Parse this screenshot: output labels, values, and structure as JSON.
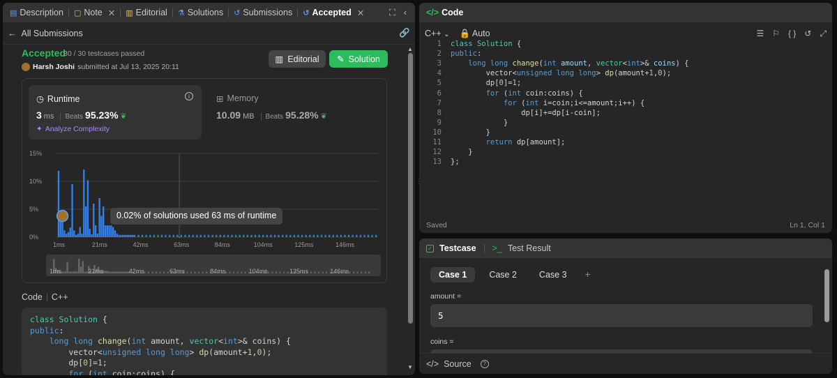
{
  "tabs": [
    {
      "icon": "document-icon",
      "label": "Description"
    },
    {
      "icon": "note-icon",
      "label": "Note",
      "closable": true
    },
    {
      "icon": "book-icon",
      "label": "Editorial"
    },
    {
      "icon": "flask-icon",
      "label": "Solutions"
    },
    {
      "icon": "history-icon",
      "label": "Submissions"
    },
    {
      "icon": "history-icon",
      "label": "Accepted",
      "closable": true,
      "active": true
    }
  ],
  "subbar": {
    "back_label": "All Submissions"
  },
  "submission": {
    "status": "Accepted",
    "testcases": "30 / 30 testcases passed",
    "user": "Harsh Joshi",
    "submitted_text": "submitted at Jul 13, 2025 20:11",
    "editorial_btn": "Editorial",
    "solution_btn": "Solution"
  },
  "runtime": {
    "label": "Runtime",
    "value": "3",
    "unit": "ms",
    "beats_label": "Beats",
    "beats": "95.23%",
    "analyze": "Analyze Complexity"
  },
  "memory": {
    "label": "Memory",
    "value": "10.09",
    "unit": "MB",
    "beats_label": "Beats",
    "beats": "95.28%"
  },
  "chart_data": {
    "type": "bar",
    "ylabels": [
      "15%",
      "10%",
      "5%",
      "0%"
    ],
    "yticks": [
      15,
      10,
      5,
      0
    ],
    "ylim": [
      0,
      15
    ],
    "xlabels": [
      "1ms",
      "21ms",
      "42ms",
      "63ms",
      "84ms",
      "104ms",
      "125ms",
      "146ms"
    ],
    "xticks": [
      1,
      21,
      42,
      63,
      84,
      104,
      125,
      146
    ],
    "xlim": [
      1,
      165
    ],
    "highlight_ms": 63,
    "user_ms": 3,
    "x": [
      1,
      2,
      3,
      4,
      5,
      6,
      7,
      8,
      9,
      10,
      11,
      12,
      13,
      14,
      15,
      16,
      17,
      18,
      19,
      20,
      21,
      22,
      23,
      24,
      25,
      26,
      27,
      28,
      29,
      30,
      31,
      32,
      33,
      34,
      35,
      36,
      37,
      38,
      39,
      40,
      42,
      44,
      46,
      48,
      50,
      52,
      54,
      56,
      58,
      60,
      62,
      63,
      64,
      66,
      68,
      70,
      72,
      74,
      76,
      78,
      80,
      82,
      84,
      86,
      88,
      90,
      92,
      94,
      96,
      98,
      100,
      102,
      104,
      106,
      108,
      110,
      112,
      114,
      116,
      118,
      120,
      122,
      124,
      126,
      128,
      130,
      132,
      134,
      136,
      138,
      140,
      142,
      144,
      146,
      148,
      150,
      152,
      154,
      156,
      158,
      160,
      162,
      164
    ],
    "values": [
      11.9,
      4.5,
      2.8,
      1.2,
      0.6,
      0.9,
      1.7,
      9.5,
      1.2,
      0.4,
      0.6,
      1.8,
      0.6,
      12.1,
      5.5,
      10.2,
      1.5,
      0.5,
      6,
      2.1,
      0.6,
      7,
      3.8,
      5.5,
      2.1,
      2.1,
      2.1,
      2.1,
      1.8,
      1.2,
      0.6,
      0.4,
      0.4,
      0.4,
      0.4,
      0.4,
      0.4,
      0.4,
      0.4,
      0.4,
      0.4,
      0.4,
      0.4,
      0.4,
      0.4,
      0.4,
      0.4,
      0.4,
      0.4,
      0.4,
      0.4,
      0.02,
      0.4,
      0.4,
      0.4,
      0.4,
      0.4,
      0.4,
      0.4,
      0.4,
      0.4,
      0.4,
      0.4,
      0.4,
      0.4,
      0.4,
      0.4,
      0.4,
      0.4,
      0.4,
      0.4,
      0.4,
      0.4,
      0.4,
      0.4,
      0.4,
      0.4,
      0.4,
      0.4,
      0.4,
      0.4,
      0.4,
      0.4,
      0.4,
      0.4,
      0.4,
      0.4,
      0.4,
      0.4,
      0.4,
      0.4,
      0.4,
      0.4,
      0.4,
      0.4,
      0.4,
      0.4,
      0.4,
      0.4,
      0.4,
      0.4,
      0.4,
      0.4
    ],
    "tooltip": "0.02% of solutions used 63 ms of runtime"
  },
  "code_section": {
    "label": "Code",
    "lang": "C++"
  },
  "code_preview": [
    [
      [
        "ty",
        "class "
      ],
      [
        "ty",
        "Solution"
      ],
      [
        "pl",
        " {"
      ]
    ],
    [
      [
        "kw",
        "public"
      ],
      [
        "pl",
        ":"
      ]
    ],
    [
      [
        "pl",
        "    "
      ],
      [
        "kw",
        "long long "
      ],
      [
        "fn",
        "change"
      ],
      [
        "pl",
        "("
      ],
      [
        "kw",
        "int "
      ],
      [
        "pl",
        "amount, "
      ],
      [
        "ty",
        "vector"
      ],
      [
        "pl",
        "<"
      ],
      [
        "kw",
        "int"
      ],
      [
        "pl",
        ">& coins) {"
      ]
    ],
    [
      [
        "pl",
        "        vector<"
      ],
      [
        "kw",
        "unsigned long long"
      ],
      [
        "pl",
        "> "
      ],
      [
        "fn",
        "dp"
      ],
      [
        "pl",
        "(amount+"
      ],
      [
        "nm",
        "1"
      ],
      [
        "pl",
        ","
      ],
      [
        "nm",
        "0"
      ],
      [
        "pl",
        ");"
      ]
    ],
    [
      [
        "pl",
        "        dp["
      ],
      [
        "nm",
        "0"
      ],
      [
        "pl",
        "]="
      ],
      [
        "nm",
        "1"
      ],
      [
        "pl",
        ";"
      ]
    ],
    [
      [
        "pl",
        "        "
      ],
      [
        "kw",
        "for "
      ],
      [
        "pl",
        "("
      ],
      [
        "kw",
        "int "
      ],
      [
        "pl",
        "coin:coins) {"
      ]
    ]
  ],
  "editor": {
    "title": "Code",
    "lang": "C++",
    "mode": "Auto",
    "status_left": "Saved",
    "status_right": "Ln 1, Col 1",
    "line_numbers": [
      "1",
      "2",
      "3",
      "4",
      "5",
      "6",
      "7",
      "8",
      "9",
      "10",
      "11",
      "12",
      "13"
    ],
    "lines": [
      [
        [
          "ty",
          "class "
        ],
        [
          "ty",
          "Solution"
        ],
        [
          "pl",
          " {"
        ]
      ],
      [
        [
          "kw",
          "public"
        ],
        [
          "pl",
          ":"
        ]
      ],
      [
        [
          "pl",
          "    "
        ],
        [
          "kw",
          "long long "
        ],
        [
          "fn",
          "change"
        ],
        [
          "pl",
          "("
        ],
        [
          "kw",
          "int "
        ],
        [
          "id",
          "amount"
        ],
        [
          "pl",
          ", "
        ],
        [
          "ty",
          "vector"
        ],
        [
          "pl",
          "<"
        ],
        [
          "kw",
          "int"
        ],
        [
          "pl",
          ">& "
        ],
        [
          "id",
          "coins"
        ],
        [
          "pl",
          ") {"
        ]
      ],
      [
        [
          "pl",
          "        vector<"
        ],
        [
          "kw",
          "unsigned long long"
        ],
        [
          "pl",
          "> "
        ],
        [
          "fn",
          "dp"
        ],
        [
          "pl",
          "(amount+"
        ],
        [
          "nm",
          "1"
        ],
        [
          "pl",
          ","
        ],
        [
          "nm",
          "0"
        ],
        [
          "pl",
          ");"
        ]
      ],
      [
        [
          "pl",
          "        dp["
        ],
        [
          "nm",
          "0"
        ],
        [
          "pl",
          "]="
        ],
        [
          "nm",
          "1"
        ],
        [
          "pl",
          ";"
        ]
      ],
      [
        [
          "pl",
          "        "
        ],
        [
          "kw",
          "for "
        ],
        [
          "pl",
          "("
        ],
        [
          "kw",
          "int "
        ],
        [
          "pl",
          "coin:coins) {"
        ]
      ],
      [
        [
          "pl",
          "            "
        ],
        [
          "kw",
          "for "
        ],
        [
          "pl",
          "("
        ],
        [
          "kw",
          "int "
        ],
        [
          "pl",
          "i=coin;i<=amount;i++) {"
        ]
      ],
      [
        [
          "pl",
          "                dp[i]+=dp[i-coin];"
        ]
      ],
      [
        [
          "pl",
          "            }"
        ]
      ],
      [
        [
          "pl",
          "        }"
        ]
      ],
      [
        [
          "pl",
          "        "
        ],
        [
          "kw",
          "return "
        ],
        [
          "pl",
          "dp[amount];"
        ]
      ],
      [
        [
          "pl",
          "    }"
        ]
      ],
      [
        [
          "pl",
          "};"
        ]
      ]
    ]
  },
  "testcase": {
    "tab1": "Testcase",
    "tab2": "Test Result",
    "cases": [
      "Case 1",
      "Case 2",
      "Case 3"
    ],
    "field1_label": "amount =",
    "field1_value": "5",
    "field2_label": "coins =",
    "source_label": "Source"
  },
  "colors": {
    "accent_green": "#2cbb5d",
    "bar_blue": "#2f80ed",
    "tooltip_bg": "#444444",
    "analyze_purple": "#a78bfa"
  }
}
